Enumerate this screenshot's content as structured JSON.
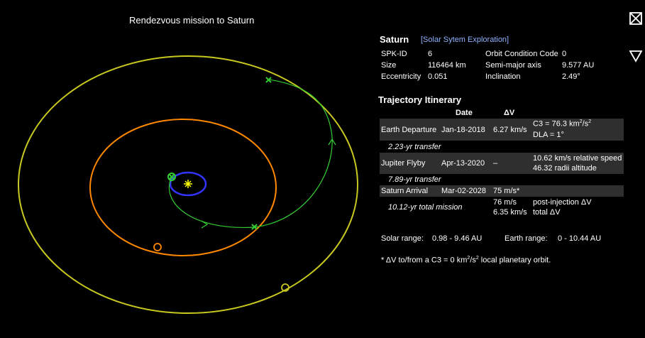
{
  "plot": {
    "title": "Rendezvous mission to Saturn"
  },
  "controls": {
    "close_icon": "close-box-icon",
    "collapse_icon": "triangle-down-icon"
  },
  "planet": {
    "name": "Saturn",
    "link_label": "[Solar Sytem Exploration]",
    "spk_id_label": "SPK-ID",
    "spk_id": "6",
    "size_label": "Size",
    "size": "116464 km",
    "ecc_label": "Eccentricity",
    "ecc": "0.051",
    "occ_label": "Orbit Condition Code",
    "occ": "0",
    "sma_label": "Semi-major axis",
    "sma": "9.577 AU",
    "inc_label": "Inclination",
    "inc": "2.49°"
  },
  "itinerary": {
    "title": "Trajectory Itinerary",
    "col_date": "Date",
    "col_dv": "ΔV",
    "departure": {
      "event": "Earth Departure",
      "date": "Jan-18-2018",
      "dv": "6.27 km/s",
      "c3_prefix": "C3 = 76.3 km",
      "c3_sup": "2",
      "c3_mid": "/s",
      "c3_sup2": "2",
      "dla": "DLA = 1°"
    },
    "transfer1": "2.23-yr transfer",
    "flyby": {
      "event": "Jupiter Flyby",
      "date": "Apr-13-2020",
      "dv": "–",
      "note1": "10.62 km/s relative speed",
      "note2": "46.32 radii altitude"
    },
    "transfer2": "7.89-yr transfer",
    "arrival": {
      "event": "Saturn Arrival",
      "date": "Mar-02-2028",
      "dv": "75 m/s*"
    },
    "total": {
      "label": "10.12-yr total mission",
      "dv1": "76 m/s",
      "dv1_label": "post-injection ΔV",
      "dv2": "6.35 km/s",
      "dv2_label": "total ΔV"
    },
    "solar_range_label": "Solar range:",
    "solar_range": "0.98 - 9.46 AU",
    "earth_range_label": "Earth range:",
    "earth_range": "0 - 10.44 AU",
    "footnote_a": "* ΔV to/from a C3 = 0 km",
    "footnote_sup": "2",
    "footnote_b": "/s",
    "footnote_sup2": "2",
    "footnote_c": " local planetary orbit."
  },
  "colors": {
    "sun": "#ffff00",
    "earth_orbit": "#3333ff",
    "jupiter_orbit": "#ff8800",
    "saturn_orbit": "#c8c820",
    "trajectory": "#33cc33"
  }
}
